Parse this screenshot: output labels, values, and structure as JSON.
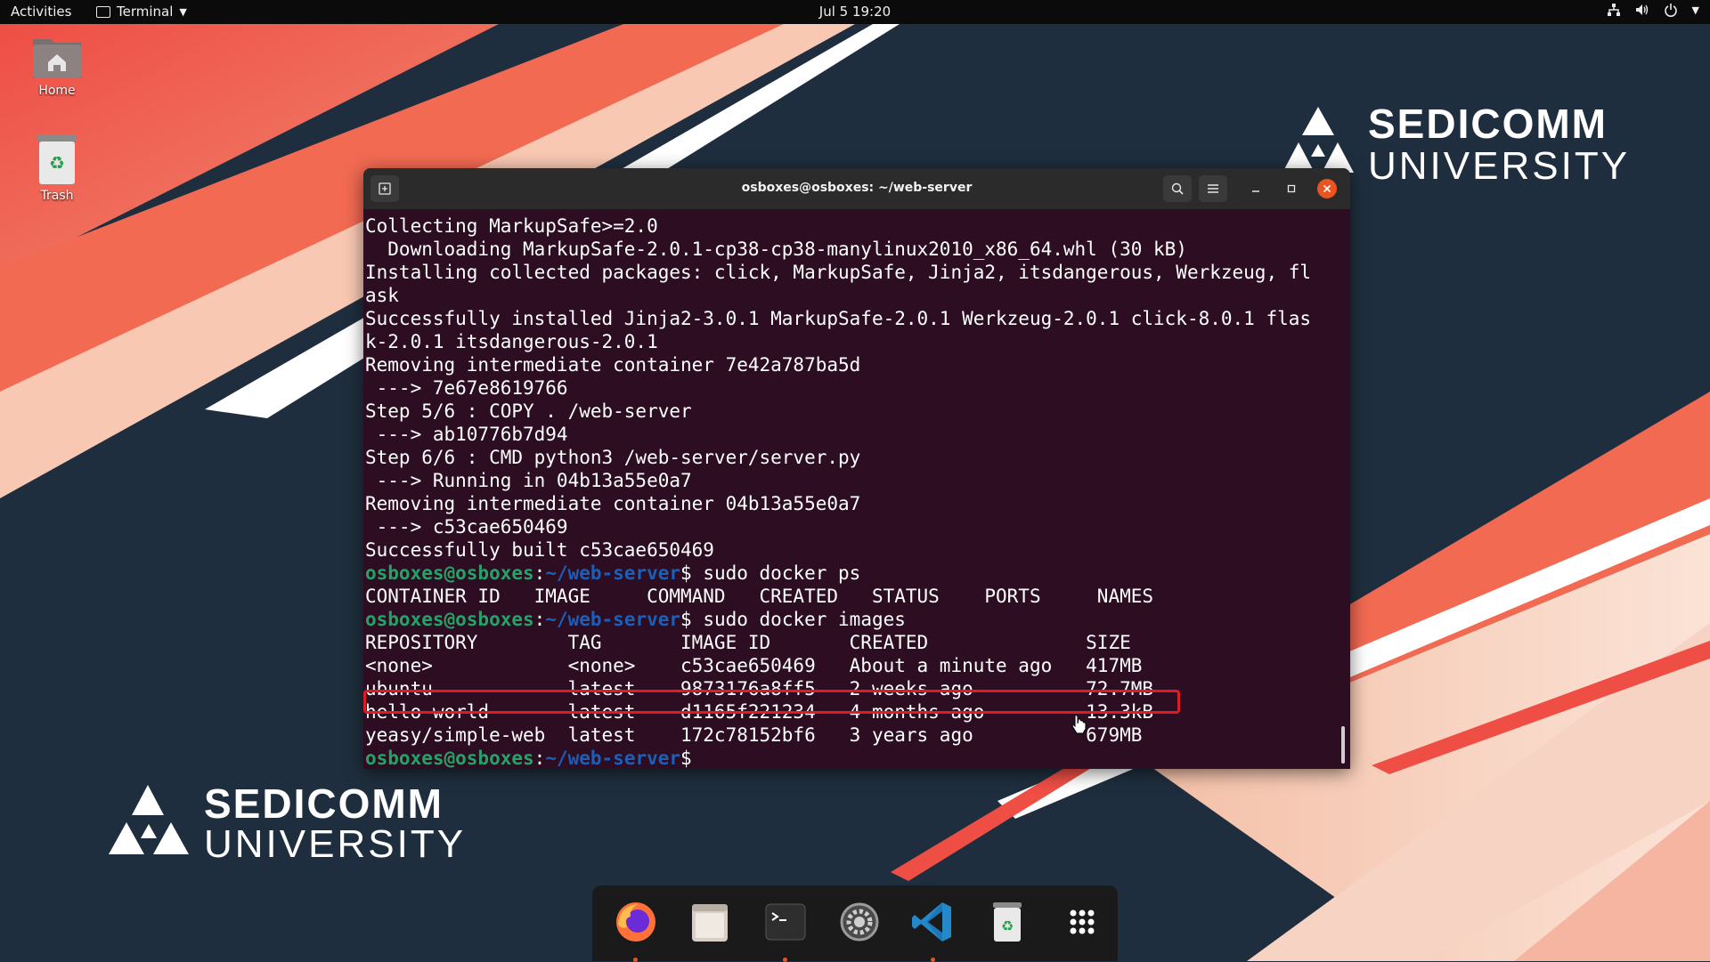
{
  "topbar": {
    "activities": "Activities",
    "app_name": "Terminal",
    "clock": "Jul 5  19:20"
  },
  "desktop": {
    "home_label": "Home",
    "trash_label": "Trash"
  },
  "brand": {
    "name": "SEDICOMM",
    "sub": "UNIVERSITY"
  },
  "terminal": {
    "title": "osboxes@osboxes: ~/web-server",
    "prompt_user": "osboxes@osboxes",
    "prompt_path": "~/web-server",
    "lines": [
      {
        "text": "Collecting MarkupSafe>=2.0"
      },
      {
        "text": "  Downloading MarkupSafe-2.0.1-cp38-cp38-manylinux2010_x86_64.whl (30 kB)"
      },
      {
        "text": "Installing collected packages: click, MarkupSafe, Jinja2, itsdangerous, Werkzeug, fl"
      },
      {
        "text": "ask"
      },
      {
        "text": "Successfully installed Jinja2-3.0.1 MarkupSafe-2.0.1 Werkzeug-2.0.1 click-8.0.1 flas"
      },
      {
        "text": "k-2.0.1 itsdangerous-2.0.1"
      },
      {
        "text": "Removing intermediate container 7e42a787ba5d"
      },
      {
        "text": " ---> 7e67e8619766"
      },
      {
        "text": "Step 5/6 : COPY . /web-server"
      },
      {
        "text": " ---> ab10776b7d94"
      },
      {
        "text": "Step 6/6 : CMD python3 /web-server/server.py"
      },
      {
        "text": " ---> Running in 04b13a55e0a7"
      },
      {
        "text": "Removing intermediate container 04b13a55e0a7"
      },
      {
        "text": " ---> c53cae650469"
      },
      {
        "text": "Successfully built c53cae650469"
      },
      {
        "prompt": true,
        "text": "$ sudo docker ps"
      },
      {
        "text": "CONTAINER ID   IMAGE     COMMAND   CREATED   STATUS    PORTS     NAMES"
      },
      {
        "prompt": true,
        "text": "$ sudo docker images"
      },
      {
        "text": "REPOSITORY        TAG       IMAGE ID       CREATED              SIZE"
      },
      {
        "text": "<none>            <none>    c53cae650469   About a minute ago   417MB"
      },
      {
        "text": "ubuntu            latest    9873176a8ff5   2 weeks ago          72.7MB"
      },
      {
        "text": "hello-world       latest    d1165f221234   4 months ago         13.3kB"
      },
      {
        "text": "yeasy/simple-web  latest    172c78152bf6   3 years ago          679MB"
      },
      {
        "prompt": true,
        "text": "$ "
      }
    ]
  },
  "dock": {
    "items": [
      "firefox-icon",
      "files-icon",
      "terminal-icon",
      "settings-icon",
      "vscode-icon",
      "trash-icon",
      "app-grid-icon"
    ]
  },
  "colors": {
    "terminal_bg": "#2c0d22",
    "prompt_user": "#26a269",
    "prompt_path": "#1c5fb8",
    "highlight": "#e01b24",
    "accent": "#e95420"
  }
}
